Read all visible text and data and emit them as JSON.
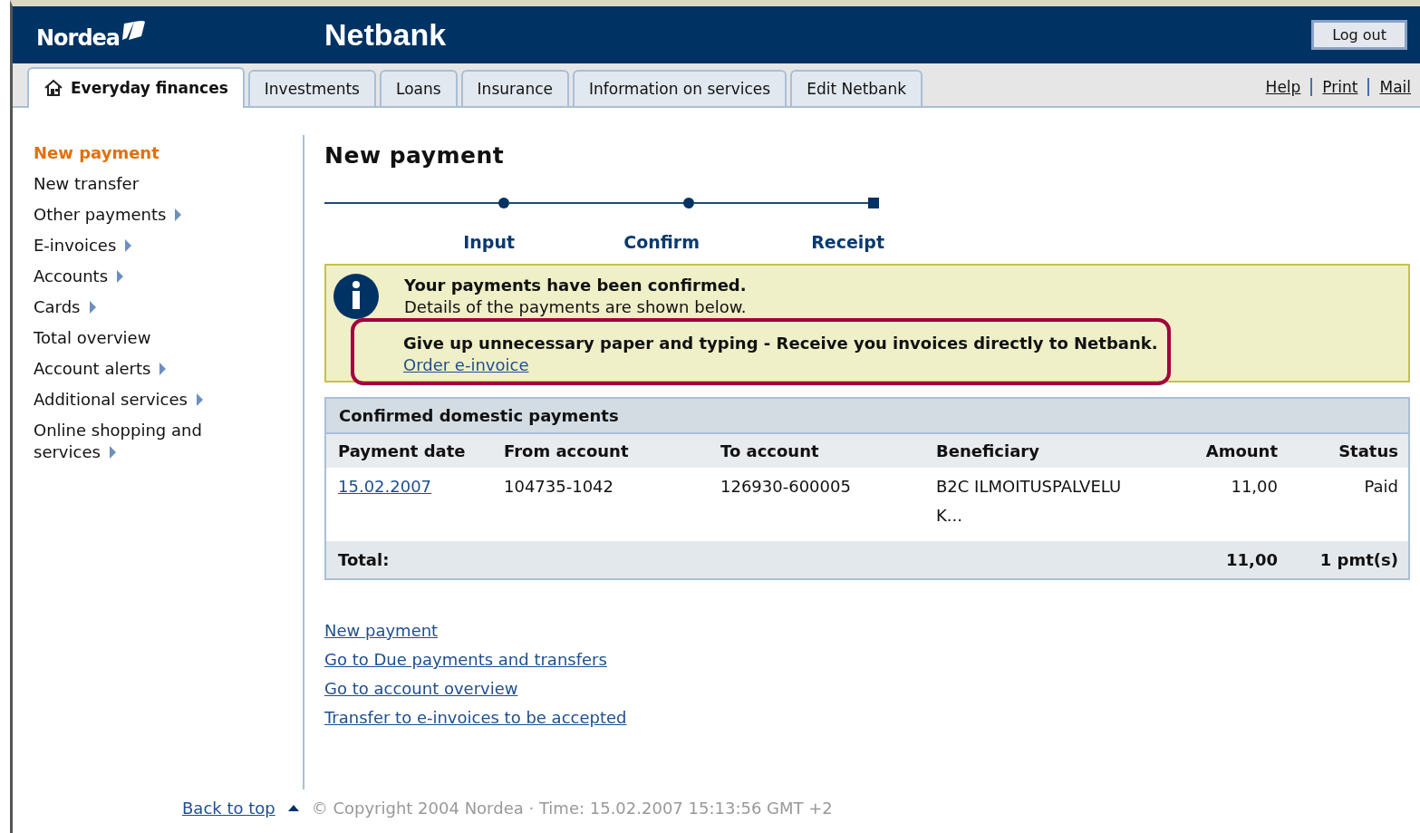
{
  "header": {
    "logo": "Nordea",
    "title": "Netbank",
    "logout": "Log out"
  },
  "tabs": [
    {
      "label": "Everyday finances",
      "selected": true,
      "kind": "home"
    },
    {
      "label": "Investments",
      "selected": false,
      "kind": "plain"
    },
    {
      "label": "Loans",
      "selected": false,
      "kind": "plain"
    },
    {
      "label": "Insurance",
      "selected": false,
      "kind": "plain"
    },
    {
      "label": "Information on services",
      "selected": false,
      "kind": "plain"
    },
    {
      "label": "Edit Netbank",
      "selected": false,
      "kind": "plain"
    }
  ],
  "top_links": [
    "Help",
    "Print",
    "Mail"
  ],
  "sidebar": {
    "items": [
      {
        "label": "New payment",
        "selected": true,
        "submenu": false
      },
      {
        "label": "New transfer",
        "selected": false,
        "submenu": false
      },
      {
        "label": "Other payments",
        "selected": false,
        "submenu": true
      },
      {
        "label": "E-invoices",
        "selected": false,
        "submenu": true
      },
      {
        "label": "Accounts",
        "selected": false,
        "submenu": true
      },
      {
        "label": "Cards",
        "selected": false,
        "submenu": true
      },
      {
        "label": "Total overview",
        "selected": false,
        "submenu": false
      },
      {
        "label": "Account alerts",
        "selected": false,
        "submenu": true
      },
      {
        "label": "Additional services",
        "selected": false,
        "submenu": true
      },
      {
        "label": "Online shopping and services",
        "selected": false,
        "submenu": true
      }
    ]
  },
  "page_title": "New payment",
  "steps": [
    {
      "label": "Input",
      "selected": false
    },
    {
      "label": "Confirm",
      "selected": false
    },
    {
      "label": "Receipt",
      "selected": true
    }
  ],
  "notice": {
    "title": "Your payments have been confirmed.",
    "text": "Details of the payments are shown below.",
    "promo": "Give up unnecessary paper and typing - Receive you invoices directly to Netbank.",
    "link": "Order e-invoice"
  },
  "table": {
    "title": "Confirmed domestic payments",
    "columns": [
      "Payment date",
      "From account",
      "To account",
      "Beneficiary",
      "Amount",
      "Status"
    ],
    "rows": [
      {
        "cells": [
          "15.02.2007",
          "104735-1042",
          "126930-600005",
          "B2C ILMOITUSPALVELU K...",
          "11,00",
          "Paid"
        ]
      }
    ],
    "total": {
      "label": "Total:",
      "amount": "11,00",
      "count": "1 pmt(s)"
    }
  },
  "links": [
    "New payment",
    "Go to Due payments and transfers",
    "Go to account overview",
    "Transfer to e-invoices to be accepted"
  ],
  "footer": {
    "back_to_top": "Back to top",
    "copyright": "© Copyright 2004 Nordea · Time: 15.02.2007 15:13:56 GMT +2"
  }
}
